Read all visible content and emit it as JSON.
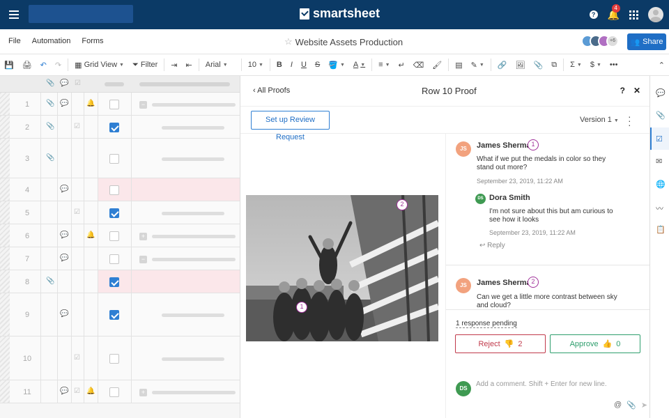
{
  "app": {
    "logo_text": "smartsheet",
    "notif_count": "4"
  },
  "menu": {
    "items": [
      "File",
      "Automation",
      "Forms"
    ]
  },
  "doc": {
    "title": "Website Assets Production",
    "collab_more": "+6",
    "share_label": "Share"
  },
  "toolbar": {
    "view": "Grid View",
    "filter": "Filter",
    "font": "Arial",
    "size": "10"
  },
  "grid": {
    "rows": [
      {
        "num": "1",
        "checked": false
      },
      {
        "num": "2",
        "checked": true
      },
      {
        "num": "3",
        "checked": false
      },
      {
        "num": "4",
        "checked": false
      },
      {
        "num": "5",
        "checked": true
      },
      {
        "num": "6",
        "checked": false
      },
      {
        "num": "7",
        "checked": false
      },
      {
        "num": "8",
        "checked": true
      },
      {
        "num": "9",
        "checked": true
      },
      {
        "num": "10",
        "checked": false
      },
      {
        "num": "11",
        "checked": false
      }
    ]
  },
  "panel": {
    "back_label": "All Proofs",
    "title": "Row 10 Proof",
    "help": "?",
    "close": "✕",
    "review_button": "Set up Review Request",
    "version": "Version 1",
    "pins": [
      "1",
      "2"
    ]
  },
  "comments": [
    {
      "initials": "JS",
      "name": "James Sherman",
      "pin": "1",
      "text": "What if we put the medals in color so they stand out more?",
      "date": "September 23, 2019, 11:22 AM"
    },
    {
      "initials": "DS",
      "name": "Dora Smith",
      "text": "I'm not sure about this but am curious to see how it looks",
      "date": "September 23, 2019, 11:22 AM",
      "reply": "Reply"
    },
    {
      "initials": "JS",
      "name": "James Sherman",
      "pin": "2",
      "text": "Can we get a little more contrast between sky and cloud?"
    }
  ],
  "review": {
    "pending": "1 response pending",
    "reject_label": "Reject",
    "reject_count": "2",
    "approve_label": "Approve",
    "approve_count": "0"
  },
  "composer": {
    "initials": "DS",
    "placeholder": "Add a comment. Shift + Enter for new line."
  },
  "colors": {
    "topbar": "#0b3a66",
    "accent": "#1f6ec5",
    "reject": "#c0394a",
    "approve": "#2e9e6d",
    "pin": "#a0309a"
  }
}
